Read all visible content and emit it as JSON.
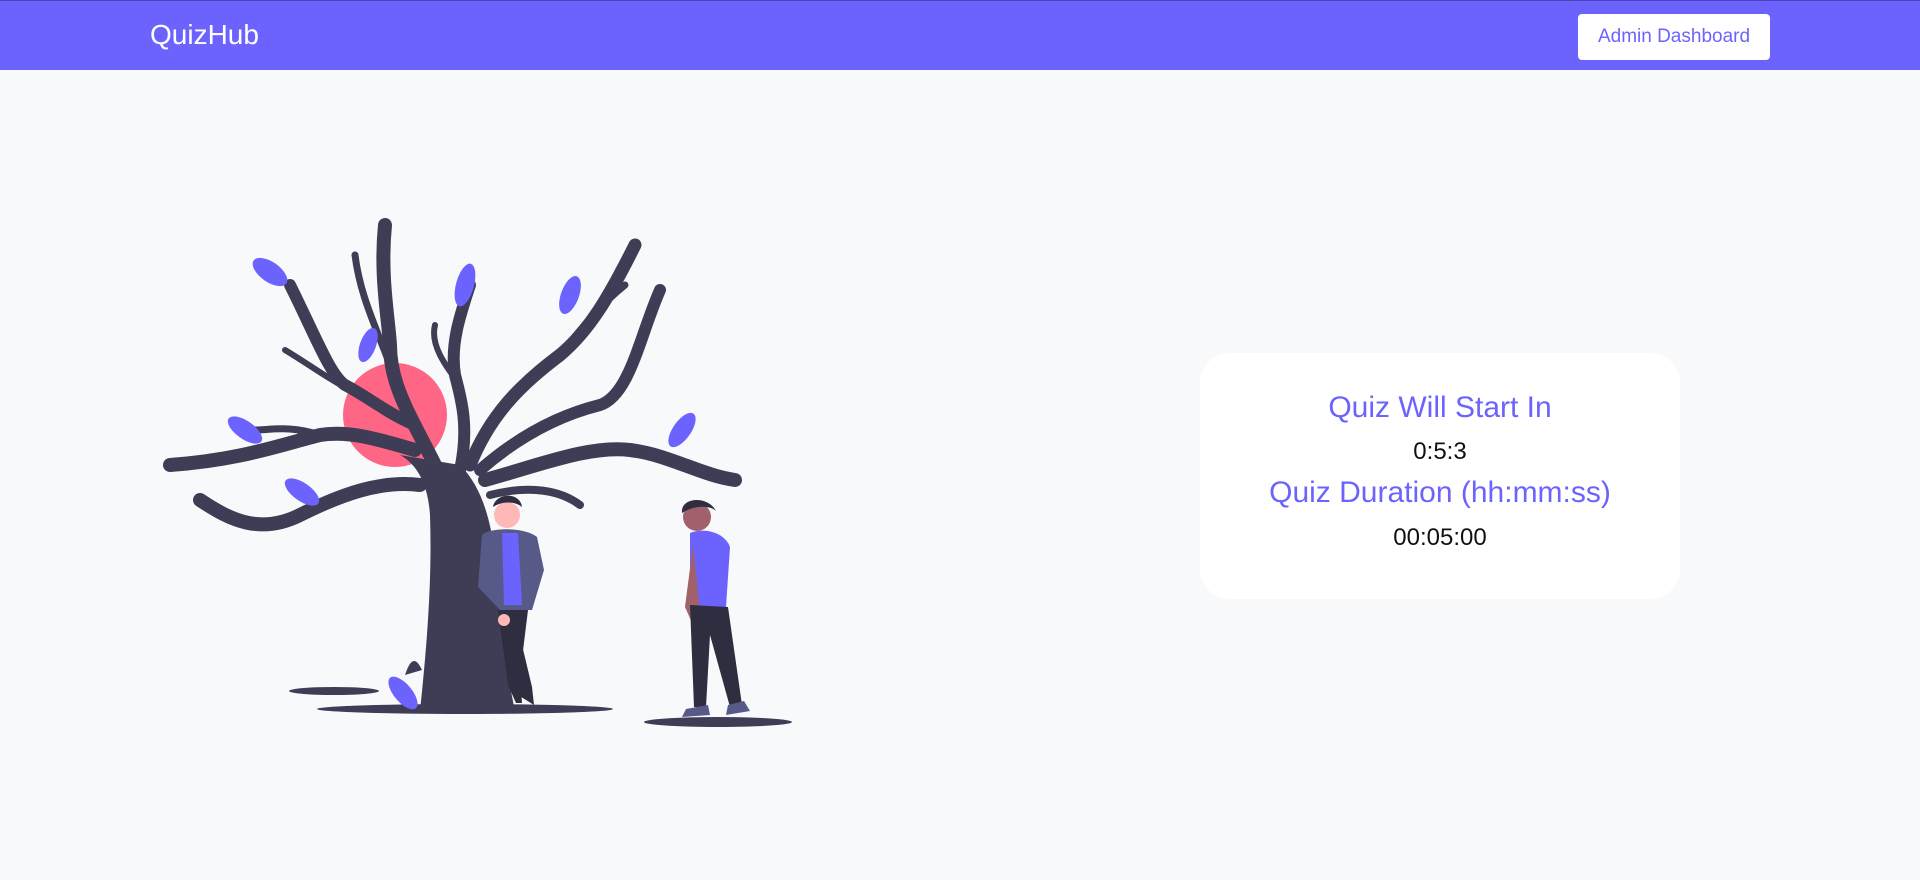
{
  "navbar": {
    "brand": "QuizHub",
    "admin_button_label": "Admin Dashboard"
  },
  "quiz_card": {
    "start_heading": "Quiz Will Start In",
    "countdown": "0:5:3",
    "duration_heading": "Quiz Duration (hh:mm:ss)",
    "duration": "00:05:00"
  },
  "colors": {
    "accent": "#6c63ff",
    "background": "#f8f9fa",
    "illustration_dark": "#3f3d56",
    "illustration_pink": "#ff6584"
  },
  "illustration": {
    "icon": "tree-and-people-illustration"
  }
}
